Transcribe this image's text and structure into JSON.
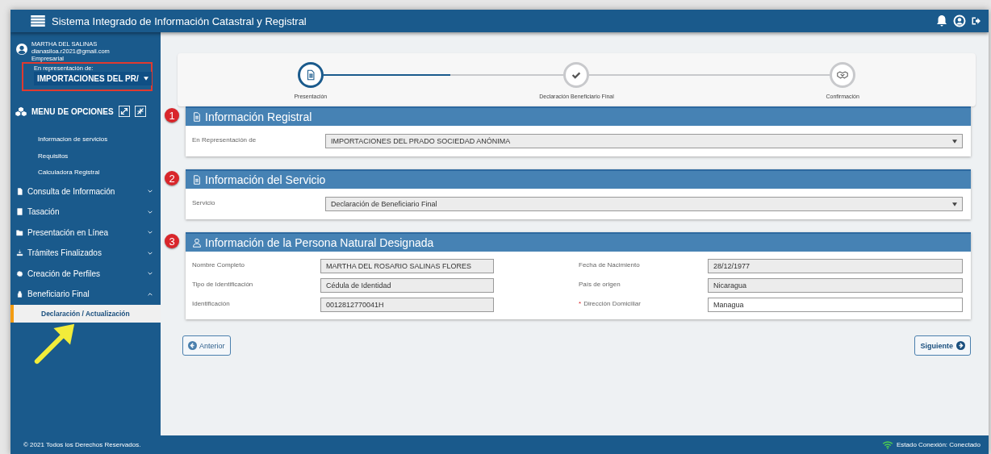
{
  "header": {
    "title": "Sistema Integrado de Información Catastral y Registral"
  },
  "user": {
    "name": "MARTHA DEL SALINAS",
    "email": "dianasiloa.r2021@gmail.com",
    "role": "Empresarial",
    "representation_label": "En representación de:",
    "representation_value": "IMPORTACIONES DEL PR/",
    "highlighted": true
  },
  "menu": {
    "title": "MENU DE OPCIONES",
    "links": [
      "Informacion de servicios",
      "Requisitos",
      "Calculadora Registral"
    ],
    "items": [
      {
        "label": "Consulta de Información",
        "expanded": false
      },
      {
        "label": "Tasación",
        "expanded": false
      },
      {
        "label": "Presentación en Línea",
        "expanded": false
      },
      {
        "label": "Trámites Finalizados",
        "expanded": false
      },
      {
        "label": "Creación de Perfiles",
        "expanded": false
      },
      {
        "label": "Beneficiario Final",
        "expanded": true,
        "children": [
          {
            "label": "Declaración / Actualización",
            "selected": true
          }
        ]
      }
    ]
  },
  "stepper": {
    "level": 0.25,
    "steps": [
      {
        "label": "Presentación",
        "selected": true
      },
      {
        "label": "Declaración Beneficiario Final",
        "selected": false
      },
      {
        "label": "Confirmación",
        "selected": false
      }
    ]
  },
  "panels": [
    {
      "badge": "1",
      "title": "Información Registral",
      "kind": "wide",
      "fields": [
        {
          "label": "En Representación de",
          "value": "IMPORTACIONES DEL PRADO SOCIEDAD ANÓNIMA",
          "kind": "select",
          "disabled": true
        }
      ]
    },
    {
      "badge": "2",
      "title": "Información del Servicio",
      "kind": "wide",
      "fields": [
        {
          "label": "Servicio",
          "value": "Declaración de Beneficiario Final",
          "kind": "select",
          "disabled": true
        }
      ]
    },
    {
      "badge": "3",
      "title": "Información de la Persona Natural Designada",
      "kind": "grid",
      "fields": [
        {
          "label": "Nombre Completo",
          "value": "MARTHA DEL ROSARIO SALINAS FLORES",
          "kind": "text",
          "disabled": true
        },
        {
          "label": "Fecha de Nacimiento",
          "value": "28/12/1977",
          "kind": "text",
          "disabled": true
        },
        {
          "label": "Tipo de Identificación",
          "value": "Cédula de Identidad",
          "kind": "text",
          "disabled": true
        },
        {
          "label": "País de origen",
          "value": "Nicaragua",
          "kind": "text",
          "disabled": true
        },
        {
          "label": "Identificación",
          "value": "0012812770041H",
          "kind": "text",
          "disabled": true
        },
        {
          "label": "Dirección Domiciliar",
          "required_mark": "*",
          "value": "Managua",
          "kind": "text",
          "disabled": false
        }
      ]
    }
  ],
  "buttons": {
    "previous": "Anterior",
    "next": "Siguiente"
  },
  "footer": {
    "copyright": "© 2021 Todos los Derechos Reservados.",
    "status": "Estado Conexión: Conectado"
  }
}
